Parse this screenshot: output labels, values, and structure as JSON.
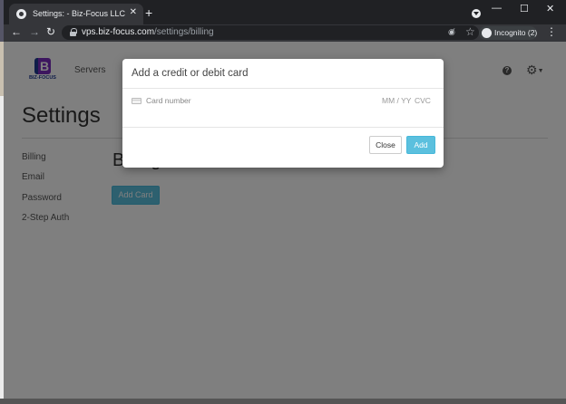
{
  "browser": {
    "tab_title": "Settings: - Biz-Focus LLC",
    "tab_close": "✕",
    "new_tab": "+",
    "url_host": "vps.biz-focus.com",
    "url_path": "/settings/billing",
    "profile_label": "Incognito (2)",
    "window_controls": {
      "minimize": "—",
      "maximize": "☐",
      "close": "✕"
    },
    "nav": {
      "back": "←",
      "forward": "→",
      "reload": "↻",
      "menu": "⋮",
      "bookmark": "☆",
      "eye_off": "◉̸"
    }
  },
  "site": {
    "logo_letter": "B",
    "logo_text": "BIZ-FOCUS",
    "nav_servers": "Servers",
    "help_glyph": "?",
    "gear_glyph": "⚙",
    "caret_glyph": "▼"
  },
  "page": {
    "title": "Settings",
    "sidebar": {
      "items": [
        {
          "label": "Billing"
        },
        {
          "label": "Email"
        },
        {
          "label": "Password"
        },
        {
          "label": "2-Step Auth"
        }
      ]
    },
    "section_heading": "Billing",
    "add_card_label": "Add Card"
  },
  "modal": {
    "title": "Add a credit or debit card",
    "card_number_placeholder": "Card number",
    "expiry_placeholder": "MM / YY",
    "cvc_placeholder": "CVC",
    "close_label": "Close",
    "add_label": "Add"
  },
  "colors": {
    "accent": "#5bc0de",
    "chrome_dark": "#202124",
    "chrome_toolbar": "#35363a",
    "brand_purple": "#7b2cbf",
    "brand_blue": "#1f3a93"
  }
}
